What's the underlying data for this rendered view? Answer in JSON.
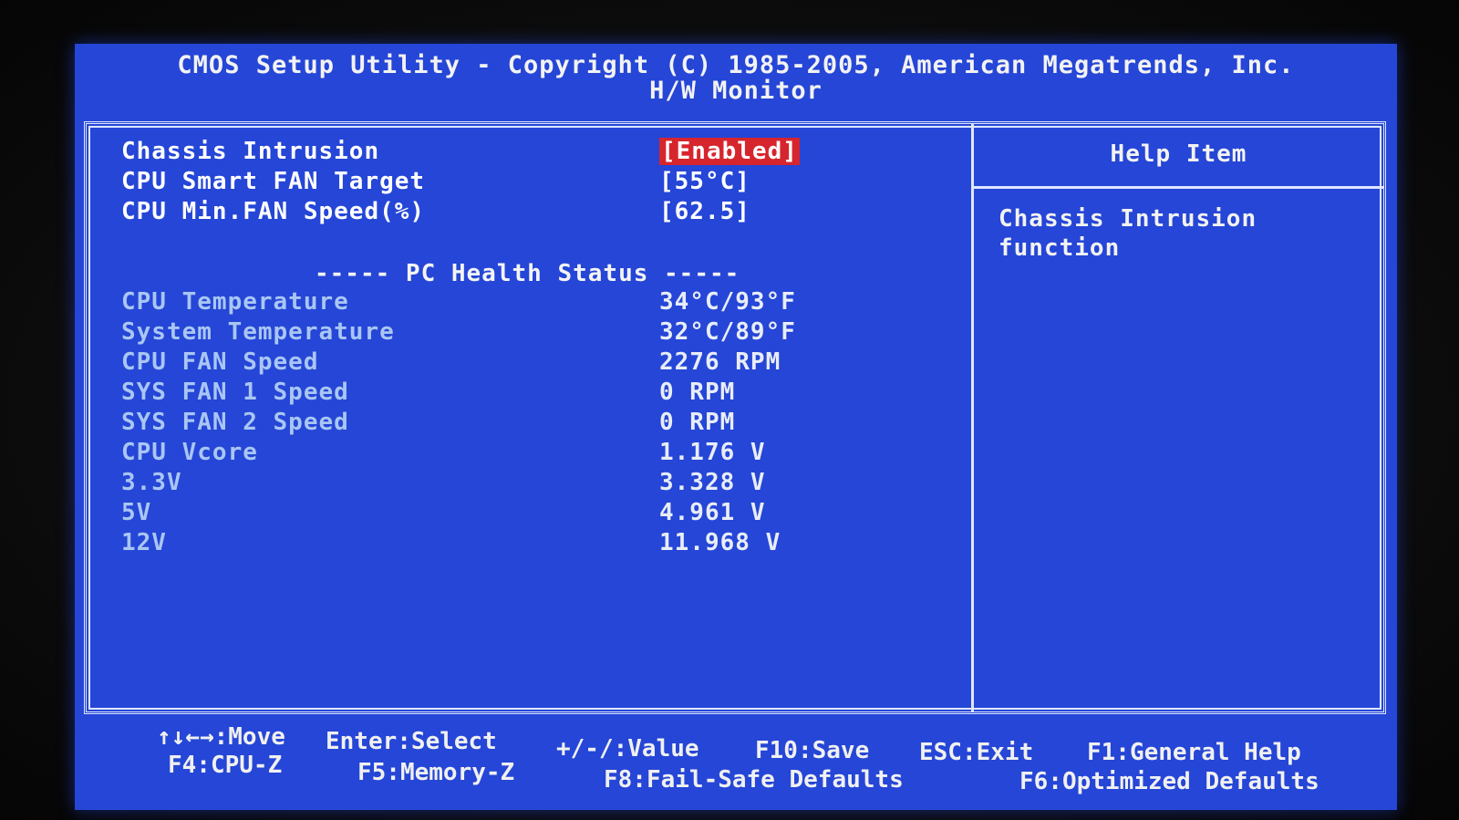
{
  "header": {
    "copyright": "CMOS Setup Utility - Copyright (C) 1985-2005, American Megatrends, Inc.",
    "subtitle": "H/W Monitor"
  },
  "settings": [
    {
      "label": "Chassis Intrusion",
      "value": "[Enabled]",
      "selected": true
    },
    {
      "label": "CPU Smart FAN Target",
      "value": "[55°C]"
    },
    {
      "label": "CPU Min.FAN Speed(%)",
      "value": "[62.5]"
    }
  ],
  "health": {
    "header": "----- PC Health Status -----",
    "items": [
      {
        "label": "CPU Temperature",
        "value": "34°C/93°F"
      },
      {
        "label": "System Temperature",
        "value": "32°C/89°F"
      },
      {
        "label": "CPU FAN Speed",
        "value": "2276 RPM"
      },
      {
        "label": "SYS FAN 1 Speed",
        "value": "0 RPM"
      },
      {
        "label": "SYS FAN 2 Speed",
        "value": "0 RPM"
      },
      {
        "label": "CPU Vcore",
        "value": "1.176 V"
      },
      {
        "label": "3.3V",
        "value": "3.328 V"
      },
      {
        "label": "5V",
        "value": "4.961 V"
      },
      {
        "label": "12V",
        "value": "11.968 V"
      }
    ]
  },
  "help": {
    "title": "Help Item",
    "text": "Chassis Intrusion function"
  },
  "footer": {
    "move": "↑↓←→:Move",
    "enter": "Enter:Select",
    "value": "+/-/:Value",
    "save": "F10:Save",
    "exit": "ESC:Exit",
    "general_help": "F1:General Help",
    "cpuz": "F4:CPU-Z",
    "memoryz": "F5:Memory-Z",
    "failsafe": "F8:Fail-Safe Defaults",
    "optimized": "F6:Optimized Defaults"
  },
  "colors": {
    "background": "#2546d6",
    "highlight": "#d7252d",
    "dim_label": "#a9c6f4"
  }
}
